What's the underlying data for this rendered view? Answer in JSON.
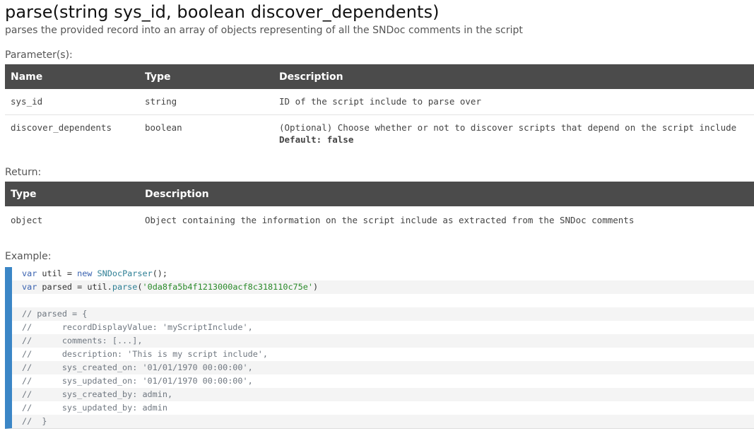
{
  "signature": "parse(string sys_id, boolean discover_dependents)",
  "description": "parses the provided record into an array of objects representing of all the SNDoc comments in the script",
  "parameters": {
    "label": "Parameter(s):",
    "headers": [
      "Name",
      "Type",
      "Description"
    ],
    "rows": [
      {
        "name": "sys_id",
        "type": "string",
        "description": "ID of the script include to parse over"
      },
      {
        "name": "discover_dependents",
        "type": "boolean",
        "description": "(Optional) Choose whether or not to discover scripts that depend on the script include",
        "default_text": "Default: false"
      }
    ]
  },
  "return": {
    "label": "Return:",
    "headers": [
      "Type",
      "Description"
    ],
    "rows": [
      {
        "type": "object",
        "description": "Object containing the information on the script include as extracted from the SNDoc comments"
      }
    ]
  },
  "example": {
    "label": "Example:",
    "code": {
      "l1": {
        "kw": "var",
        "txt1": " util = ",
        "kw2": "new",
        "fn": " SNDocParser",
        "txt2": "();"
      },
      "l2": {
        "kw": "var",
        "txt1": " parsed = util.",
        "fn": "parse",
        "txt2": "(",
        "str": "'0da8fa5b4f1213000acf8c318110c75e'",
        "txt3": ")"
      },
      "comments": [
        "// parsed = {",
        "//      recordDisplayValue: 'myScriptInclude',",
        "//      comments: [...],",
        "//      description: 'This is my script include',",
        "//      sys_created_on: '01/01/1970 00:00:00',",
        "//      sys_updated_on: '01/01/1970 00:00:00',",
        "//      sys_created_by: admin,",
        "//      sys_updated_by: admin",
        "//  }"
      ]
    }
  },
  "colors": {
    "header_bg": "#4b4b4b",
    "code_bar": "#3b86c6"
  }
}
